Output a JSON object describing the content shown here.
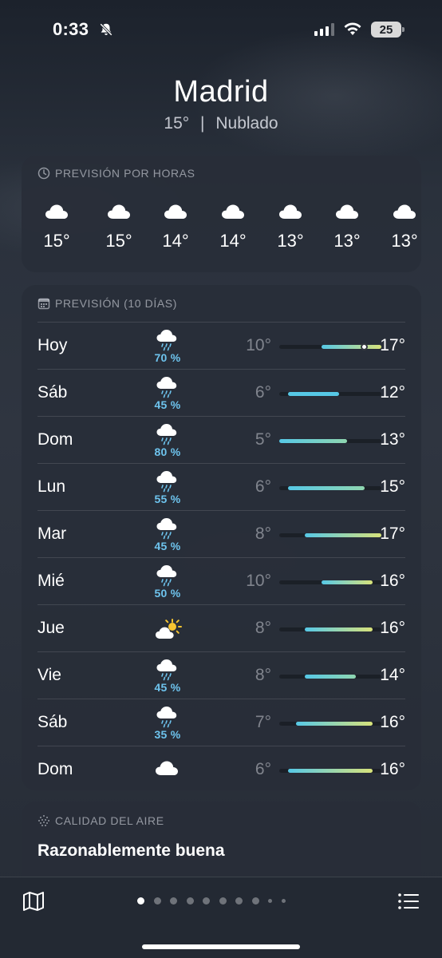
{
  "status_bar": {
    "time": "0:33",
    "battery": "25"
  },
  "header": {
    "city": "Madrid",
    "temp": "15°",
    "separator": "|",
    "condition": "Nublado"
  },
  "hourly": {
    "title": "PREVISIÓN POR HORAS",
    "items": [
      {
        "icon": "cloud-icon",
        "temp": "15°"
      },
      {
        "icon": "cloud-icon",
        "temp": "15°"
      },
      {
        "icon": "cloud-icon",
        "temp": "14°"
      },
      {
        "icon": "cloud-icon",
        "temp": "14°"
      },
      {
        "icon": "cloud-icon",
        "temp": "13°"
      },
      {
        "icon": "cloud-icon",
        "temp": "13°"
      },
      {
        "icon": "cloud-icon",
        "temp": "13°"
      }
    ]
  },
  "daily": {
    "title": "PREVISIÓN (10 DÍAS)",
    "range_min": 5,
    "range_max": 17,
    "current_temp": 15,
    "rows": [
      {
        "day": "Hoy",
        "icon": "rain-cloud-icon",
        "precip": "70 %",
        "low": "10°",
        "high": "17°",
        "low_value": 10,
        "high_value": 17
      },
      {
        "day": "Sáb",
        "icon": "rain-cloud-icon",
        "precip": "45 %",
        "low": "6°",
        "high": "12°",
        "low_value": 6,
        "high_value": 12
      },
      {
        "day": "Dom",
        "icon": "rain-cloud-icon",
        "precip": "80 %",
        "low": "5°",
        "high": "13°",
        "low_value": 5,
        "high_value": 13
      },
      {
        "day": "Lun",
        "icon": "rain-cloud-icon",
        "precip": "55 %",
        "low": "6°",
        "high": "15°",
        "low_value": 6,
        "high_value": 15
      },
      {
        "day": "Mar",
        "icon": "rain-cloud-icon",
        "precip": "45 %",
        "low": "8°",
        "high": "17°",
        "low_value": 8,
        "high_value": 17
      },
      {
        "day": "Mié",
        "icon": "rain-cloud-icon",
        "precip": "50 %",
        "low": "10°",
        "high": "16°",
        "low_value": 10,
        "high_value": 16
      },
      {
        "day": "Jue",
        "icon": "partly-sunny-icon",
        "precip": "",
        "low": "8°",
        "high": "16°",
        "low_value": 8,
        "high_value": 16
      },
      {
        "day": "Vie",
        "icon": "rain-cloud-icon",
        "precip": "45 %",
        "low": "8°",
        "high": "14°",
        "low_value": 8,
        "high_value": 14
      },
      {
        "day": "Sáb",
        "icon": "rain-cloud-icon",
        "precip": "35 %",
        "low": "7°",
        "high": "16°",
        "low_value": 7,
        "high_value": 16
      },
      {
        "day": "Dom",
        "icon": "cloud-icon",
        "precip": "",
        "low": "6°",
        "high": "16°",
        "low_value": 6,
        "high_value": 16
      }
    ]
  },
  "air_quality": {
    "title": "CALIDAD DEL AIRE",
    "value": "Razonablemente buena"
  },
  "bottom_bar": {
    "page_count": 10,
    "active_page": 0
  },
  "colors": {
    "precip_text": "#6ec4ee",
    "bar_cool": "#56c8e6",
    "bar_mild": "#8fd6b0",
    "bar_warm": "#d8e27a",
    "card_bg": "#282e38"
  }
}
